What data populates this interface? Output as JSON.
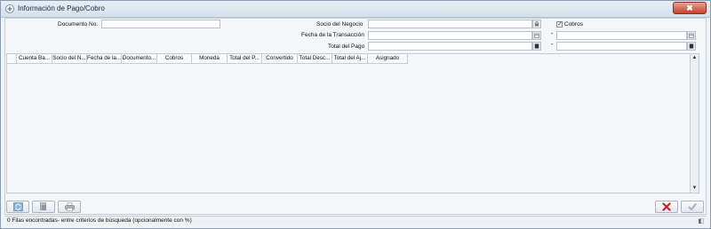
{
  "window": {
    "title": "Información de Pago/Cobro",
    "close_symbol": "✖"
  },
  "form": {
    "document_label": "Documento No.",
    "document_value": "",
    "business_partner_label": "Socio del Negocio",
    "business_partner_value": "",
    "cobros_label": "Cobros",
    "cobros_checked": true,
    "transaction_date_label": "Fecha de la Transacción",
    "date_from": "",
    "date_to": "",
    "range_separator": "-",
    "total_payment_label": "Total del Pago",
    "amount_from": "",
    "amount_to": ""
  },
  "grid": {
    "columns": [
      "",
      "Cuenta Ba...",
      "Socio del N...",
      "Fecha de la...",
      "Documento...",
      "Cobros",
      "Moneda",
      "Total del P...",
      "Convertido",
      "Total Desc...",
      "Total del Aj...",
      "Asignado"
    ],
    "rows": []
  },
  "toolbar": {
    "refresh_icon": "refresh-icon",
    "zoom_icon": "zoom-icon",
    "print_icon": "print-icon",
    "cancel_icon": "cancel-icon",
    "ok_icon": "ok-icon"
  },
  "status": {
    "text": "0 Filas encontradas- entre criterios de búsqueda (opcionalmente con %)"
  },
  "colors": {
    "title_bg": "#d5dfea",
    "close_bg": "#c8432e",
    "window_bg": "#f1f4f7",
    "cancel_red": "#c8212a",
    "ok_gray": "#a9b3bd"
  }
}
